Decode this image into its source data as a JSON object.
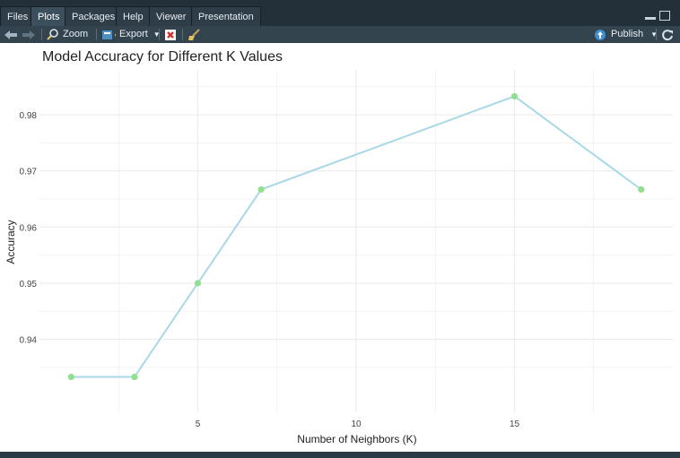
{
  "tabs": [
    {
      "label": "Files",
      "active": false
    },
    {
      "label": "Plots",
      "active": true
    },
    {
      "label": "Packages",
      "active": false
    },
    {
      "label": "Help",
      "active": false
    },
    {
      "label": "Viewer",
      "active": false
    },
    {
      "label": "Presentation",
      "active": false
    }
  ],
  "toolbar": {
    "zoom_label": "Zoom",
    "export_label": "Export",
    "publish_label": "Publish"
  },
  "colors": {
    "line": "#a9d8e6",
    "point": "#90e08f",
    "grid": "#ececec"
  },
  "chart_data": {
    "type": "line",
    "title": "Model Accuracy for Different K Values",
    "xlabel": "Number of Neighbors (K)",
    "ylabel": "Accuracy",
    "x": [
      1,
      3,
      5,
      7,
      15,
      19
    ],
    "values": [
      0.9333,
      0.9333,
      0.95,
      0.9667,
      0.9833,
      0.9667
    ],
    "xlim": [
      0,
      20
    ],
    "ylim": [
      0.927,
      0.988
    ],
    "xticks": [
      5,
      10,
      15
    ],
    "yticks": [
      0.94,
      0.95,
      0.96,
      0.97,
      0.98
    ],
    "xtick_labels": [
      "5",
      "10",
      "15"
    ],
    "ytick_labels": [
      "0.94",
      "0.95",
      "0.96",
      "0.97",
      "0.98"
    ],
    "grid": true
  }
}
